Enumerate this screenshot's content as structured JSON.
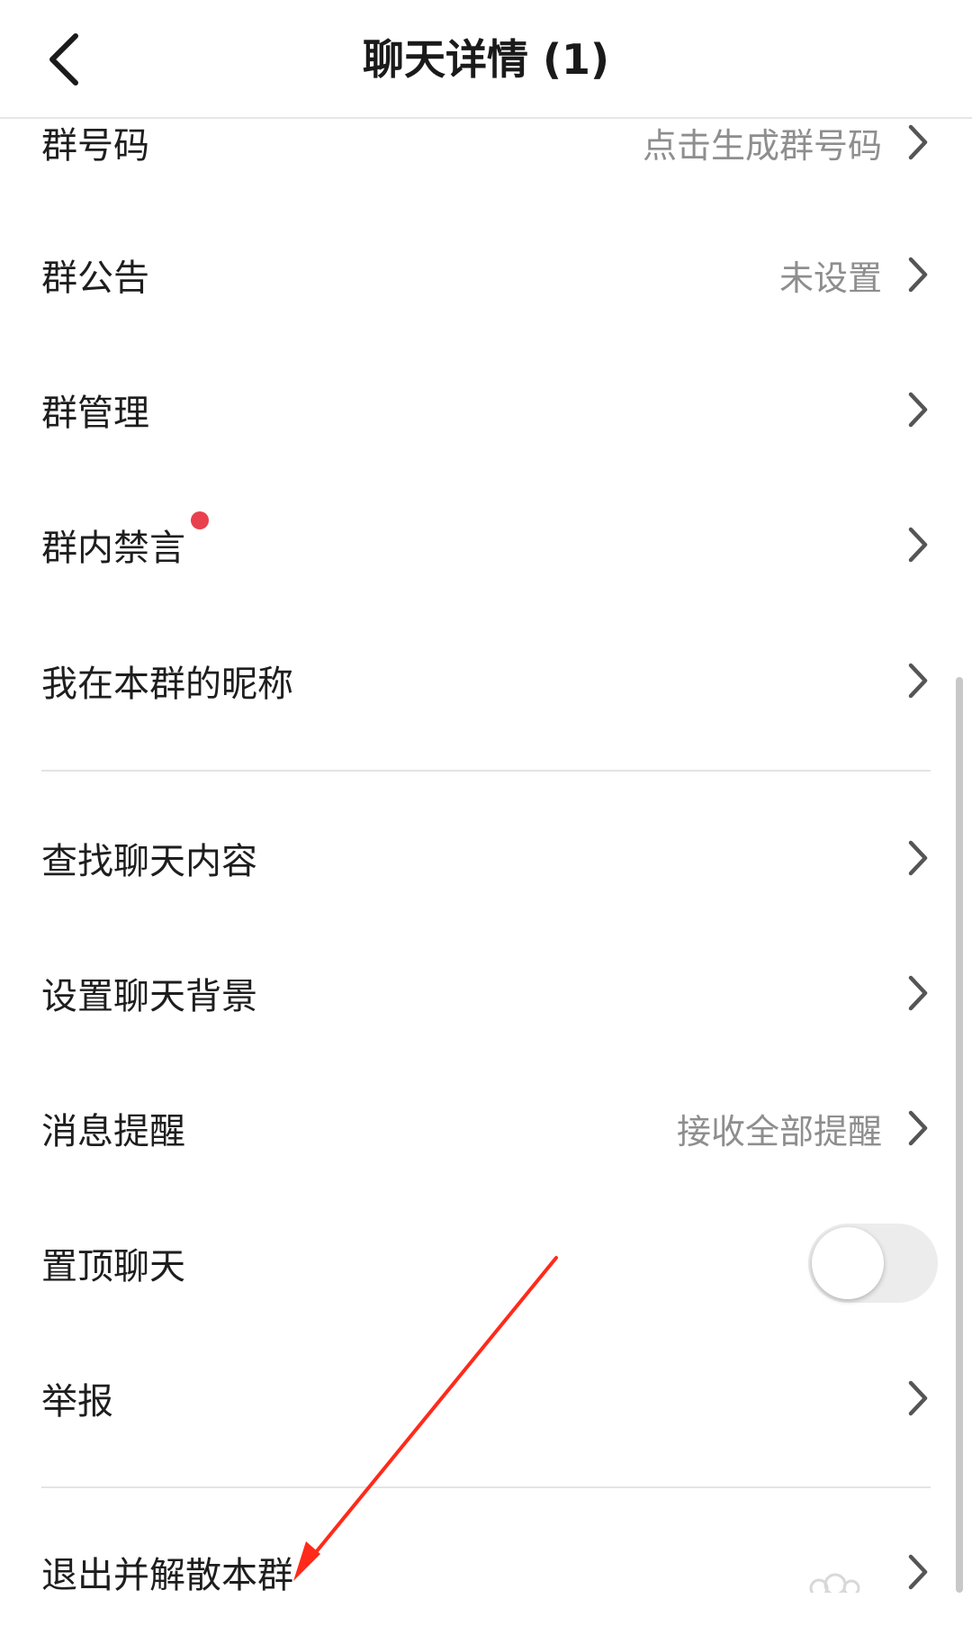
{
  "header": {
    "title": "聊天详情 (1)",
    "back_icon": "chevron-left-icon"
  },
  "settings": {
    "group_number": {
      "label": "群号码",
      "value": "点击生成群号码"
    },
    "group_notice": {
      "label": "群公告",
      "value": "未设置"
    },
    "group_manage": {
      "label": "群管理"
    },
    "group_mute": {
      "label": "群内禁言",
      "badge_color": "#e8404e"
    },
    "my_nickname": {
      "label": "我在本群的昵称"
    },
    "search_history": {
      "label": "查找聊天内容"
    },
    "chat_background": {
      "label": "设置聊天背景"
    },
    "notifications": {
      "label": "消息提醒",
      "value": "接收全部提醒"
    },
    "pin_chat": {
      "label": "置顶聊天",
      "toggle_on": false
    },
    "report": {
      "label": "举报"
    },
    "quit_disband": {
      "label": "退出并解散本群"
    }
  },
  "annotation": {
    "arrow_color": "#ff2a1a"
  }
}
